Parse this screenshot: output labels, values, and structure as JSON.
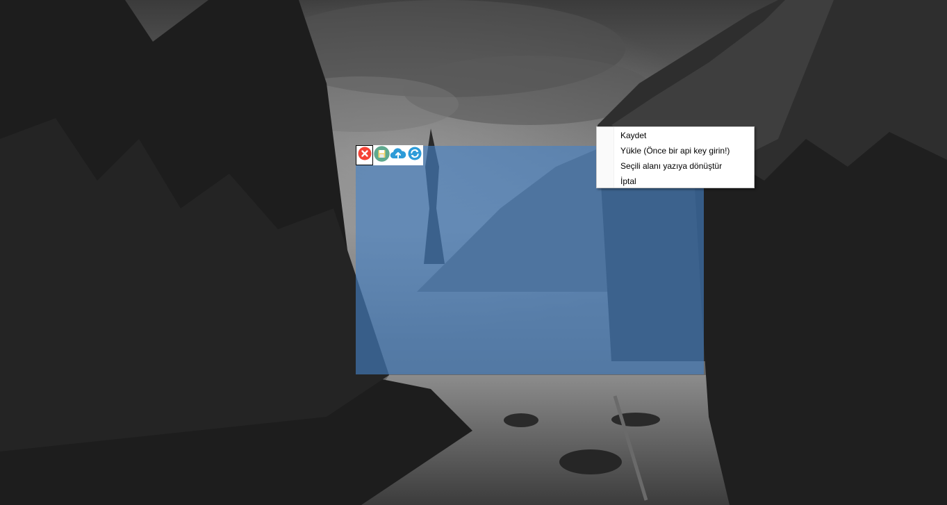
{
  "toolbar": {
    "buttons": [
      {
        "icon": "close-icon",
        "color": "#f44336"
      },
      {
        "icon": "save-icon",
        "color": "#5fa98f"
      },
      {
        "icon": "cloud-upload-icon",
        "color": "#2d9bd8"
      },
      {
        "icon": "convert-icon",
        "color": "#2d9bd8"
      }
    ]
  },
  "context_menu": {
    "items": [
      {
        "label": "Kaydet"
      },
      {
        "label": "Yükle (Önce bir api key girin!)"
      },
      {
        "label": "Seçili alanı yazıya dönüştür"
      },
      {
        "label": "İptal"
      }
    ]
  },
  "selection": {
    "color": "#4682c8"
  }
}
